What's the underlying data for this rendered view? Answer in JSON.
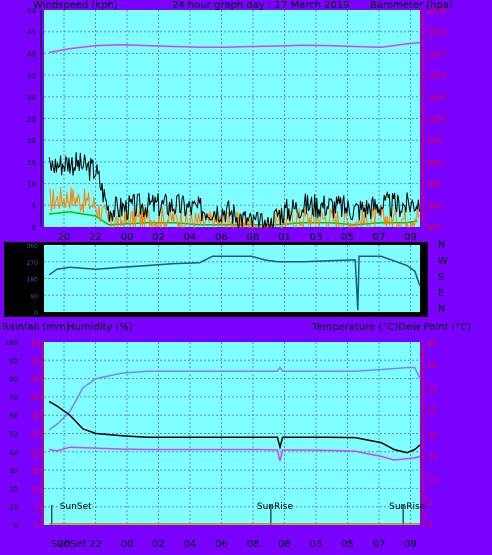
{
  "colors": {
    "background": "#7a00ff",
    "plot_bg": "#7fffff",
    "grid": "#5b8fb0",
    "axis_left": "#000000",
    "axis_red": "#ff0000",
    "barometer": "#d040ff",
    "wind_avg": "#ff8000",
    "wind_gust": "#000000",
    "wind_ground": "#00c000",
    "direction": "#1f5a7a",
    "humidity": "#8080ff",
    "temperature": "#000000",
    "dewpoint": "#d040ff",
    "rainfall": "#d08000",
    "sun_marker": "#000000"
  },
  "top_header": {
    "left": "Windspeed (kph)",
    "center": "24 hour graph day : 17 March 2019",
    "right": "Barometer (hpa)"
  },
  "bottom_header": {
    "left1": "Rainfall (mm)",
    "left2": "Humidity (%)",
    "right": "Temperature (°C)Dew Point (°C)"
  },
  "time_ticks": [
    "20",
    "22",
    "00",
    "02",
    "04",
    "06",
    "08",
    "01",
    "03",
    "05",
    "07",
    "09"
  ],
  "bottom_time_ticks": [
    "20",
    "22",
    "00",
    "02",
    "04",
    "06",
    "08",
    "08",
    "03",
    "05",
    "07",
    "09"
  ],
  "bottom_time_first": "SunSet",
  "direction_labels": [
    "N",
    "W",
    "S",
    "E",
    "N"
  ],
  "direction_ticks": [
    "360",
    "270",
    "180",
    "90",
    "0"
  ],
  "sun_labels": [
    "SunSet",
    "SunRise",
    "SunRise"
  ],
  "chart_data": [
    {
      "type": "line",
      "title": "24 hour graph day : 17 March 2019",
      "x_unit": "hour",
      "x_range": [
        19,
        33.5
      ],
      "left_axis": {
        "label": "Windspeed (kph)",
        "range": [
          0,
          50
        ],
        "ticks": [
          "0",
          "5",
          "10",
          "15",
          "20",
          "25",
          "30",
          "35",
          "40",
          "45",
          "50"
        ]
      },
      "right_axis": {
        "label": "Barometer (hpa)",
        "range": [
          975,
          1025
        ],
        "ticks": [
          "975",
          "980",
          "985",
          "990",
          "995",
          "1000",
          "1005",
          "1010",
          "1015",
          "1020",
          "1025"
        ]
      },
      "series": [
        {
          "name": "Barometer (hpa)",
          "axis": "right",
          "points": [
            [
              19.2,
              1015.2
            ],
            [
              20,
              1016.1
            ],
            [
              21,
              1016.8
            ],
            [
              22,
              1017.0
            ],
            [
              23,
              1016.8
            ],
            [
              24,
              1016.6
            ],
            [
              25,
              1016.4
            ],
            [
              26,
              1016.4
            ],
            [
              27,
              1016.6
            ],
            [
              28,
              1016.7
            ],
            [
              29,
              1016.9
            ],
            [
              30,
              1016.8
            ],
            [
              31,
              1016.6
            ],
            [
              32,
              1016.4
            ],
            [
              33,
              1017.2
            ],
            [
              33.5,
              1017.5
            ]
          ]
        }
      ],
      "wind_gust_avg_profile": [
        [
          19.2,
          14
        ],
        [
          20,
          15
        ],
        [
          21,
          13
        ],
        [
          21.5,
          4
        ],
        [
          23,
          5
        ],
        [
          24,
          5
        ],
        [
          25,
          4
        ],
        [
          26,
          4
        ],
        [
          27,
          1
        ],
        [
          27.7,
          0
        ],
        [
          28,
          3
        ],
        [
          29,
          5
        ],
        [
          30,
          5
        ],
        [
          31,
          4
        ],
        [
          32,
          5
        ],
        [
          33,
          5
        ],
        [
          33.5,
          6
        ]
      ],
      "wind_avg_profile": [
        [
          19.2,
          6
        ],
        [
          20,
          7
        ],
        [
          21,
          5
        ],
        [
          21.5,
          1
        ],
        [
          23,
          2
        ],
        [
          24,
          2
        ],
        [
          25,
          1
        ],
        [
          26,
          1
        ],
        [
          27,
          0
        ],
        [
          27.7,
          0
        ],
        [
          28,
          1
        ],
        [
          29,
          2
        ],
        [
          30,
          2
        ],
        [
          31,
          1
        ],
        [
          32,
          2
        ],
        [
          33,
          2
        ],
        [
          33.5,
          3
        ]
      ]
    },
    {
      "type": "line",
      "title": "Wind direction",
      "x_range": [
        19,
        33.5
      ],
      "y_range": [
        0,
        360
      ],
      "ticks": [
        "360",
        "270",
        "180",
        "90",
        "0"
      ],
      "series": [
        {
          "name": "Direction",
          "points": [
            [
              19.2,
              200
            ],
            [
              19.5,
              230
            ],
            [
              20,
              240
            ],
            [
              21,
              230
            ],
            [
              22,
              240
            ],
            [
              23,
              250
            ],
            [
              24,
              260
            ],
            [
              25,
              265
            ],
            [
              25.5,
              300
            ],
            [
              26,
              300
            ],
            [
              27,
              300
            ],
            [
              27.5,
              280
            ],
            [
              28,
              270
            ],
            [
              29,
              270
            ],
            [
              30,
              275
            ],
            [
              31,
              280
            ],
            [
              31.1,
              10
            ],
            [
              31.15,
              300
            ],
            [
              32,
              300
            ],
            [
              33,
              250
            ],
            [
              33.3,
              220
            ],
            [
              33.5,
              140
            ]
          ]
        }
      ]
    },
    {
      "type": "line",
      "title": "Temperature / Humidity",
      "x_range": [
        19,
        33.5
      ],
      "left_axis": {
        "label": "Humidity (%)",
        "range": [
          0,
          100
        ],
        "ticks": [
          "0",
          "10",
          "20",
          "30",
          "40",
          "50",
          "60",
          "70",
          "80",
          "90",
          "100"
        ]
      },
      "red_axis": {
        "label": "Rainfall (mm)",
        "range": [
          0,
          50
        ],
        "ticks": [
          "0",
          "5",
          "10",
          "15",
          "20",
          "25",
          "30",
          "35",
          "40",
          "45",
          "50"
        ]
      },
      "right_axis": {
        "label": "Temperature (°C)Dew Point (°C)",
        "range": [
          0,
          40
        ],
        "ticks": [
          "0",
          "5",
          "10",
          "15",
          "20",
          "25",
          "30",
          "35",
          "40"
        ]
      },
      "series": [
        {
          "name": "Humidity (%)",
          "axis": "left",
          "points": [
            [
              19.2,
              52
            ],
            [
              19.5,
              55
            ],
            [
              20,
              62
            ],
            [
              20.5,
              75
            ],
            [
              21,
              80
            ],
            [
              22,
              83
            ],
            [
              23,
              84
            ],
            [
              24,
              84
            ],
            [
              25,
              84
            ],
            [
              26,
              84
            ],
            [
              27,
              84
            ],
            [
              28,
              84
            ],
            [
              28.1,
              86
            ],
            [
              28.2,
              84
            ],
            [
              29,
              84
            ],
            [
              30,
              84
            ],
            [
              31,
              84
            ],
            [
              32,
              85
            ],
            [
              33,
              86
            ],
            [
              33.3,
              86
            ],
            [
              33.5,
              80
            ]
          ]
        },
        {
          "name": "Temperature (°C)",
          "axis": "right",
          "points": [
            [
              19.2,
              27
            ],
            [
              19.5,
              26
            ],
            [
              20,
              24
            ],
            [
              20.5,
              21
            ],
            [
              21,
              20
            ],
            [
              22,
              19.5
            ],
            [
              23,
              19.2
            ],
            [
              24,
              19.2
            ],
            [
              25,
              19.2
            ],
            [
              26,
              19.2
            ],
            [
              27,
              19.2
            ],
            [
              28,
              19.2
            ],
            [
              28.1,
              17
            ],
            [
              28.2,
              19.2
            ],
            [
              29,
              19.2
            ],
            [
              30,
              19.2
            ],
            [
              31,
              19.1
            ],
            [
              32,
              18
            ],
            [
              32.5,
              16.5
            ],
            [
              33,
              15.8
            ],
            [
              33.3,
              16.5
            ],
            [
              33.5,
              17.5
            ]
          ]
        },
        {
          "name": "Dew Point (°C)",
          "axis": "right",
          "points": [
            [
              19.2,
              16.5
            ],
            [
              19.5,
              16.2
            ],
            [
              20,
              17
            ],
            [
              21,
              16.8
            ],
            [
              22,
              16.6
            ],
            [
              23,
              16.5
            ],
            [
              24,
              16.5
            ],
            [
              25,
              16.5
            ],
            [
              26,
              16.5
            ],
            [
              27,
              16.5
            ],
            [
              28,
              16.4
            ],
            [
              28.1,
              14
            ],
            [
              28.2,
              16.4
            ],
            [
              29,
              16.4
            ],
            [
              30,
              16.3
            ],
            [
              31,
              16.1
            ],
            [
              32,
              15
            ],
            [
              32.5,
              14.2
            ],
            [
              33,
              14.5
            ],
            [
              33.3,
              14.7
            ],
            [
              33.5,
              15
            ]
          ]
        },
        {
          "name": "Rainfall (mm)",
          "axis": "red",
          "points": [
            [
              19.2,
              0.3
            ],
            [
              33.5,
              0.3
            ]
          ]
        }
      ],
      "sun_events": [
        {
          "label": "SunSet",
          "hour": 19.3
        },
        {
          "label": "SunRise",
          "hour": 27.75
        },
        {
          "label": "SunRise",
          "hour": 32.85
        }
      ]
    }
  ]
}
